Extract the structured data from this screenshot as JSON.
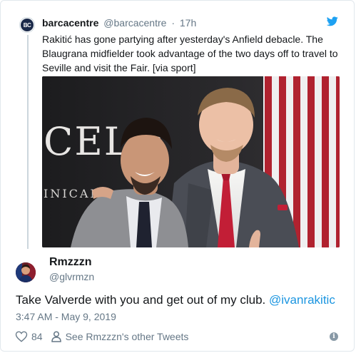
{
  "quoted": {
    "name": "barcacentre",
    "handle": "@barcacentre",
    "separator": "·",
    "time": "17h",
    "avatar_icon": "barcacentre-logo-icon",
    "avatar_text": "BC",
    "text": "Rakitić has gone partying after yesterday's Anfield debacle. The Blaugrana midfielder took advantage of the two days off to travel to Seville and visit the Fair. [via sport]",
    "photo_sign_top": "CELÓ",
    "photo_sign_bottom": "INICAN"
  },
  "reply": {
    "name": "Rmzzzn",
    "handle": "@glvrmzn",
    "text_main": "Take Valverde with you and get out of my club. ",
    "mention": "@ivanrakitic",
    "timestamp": "3:47 AM - May 9, 2019"
  },
  "actions": {
    "like_count": "84",
    "other_tweets_label": "See Rmzzzn's other Tweets",
    "info_glyph": "i"
  },
  "colors": {
    "accent": "#1b95e0",
    "muted": "#657786",
    "text": "#14171a",
    "border": "#e1e8ed"
  }
}
